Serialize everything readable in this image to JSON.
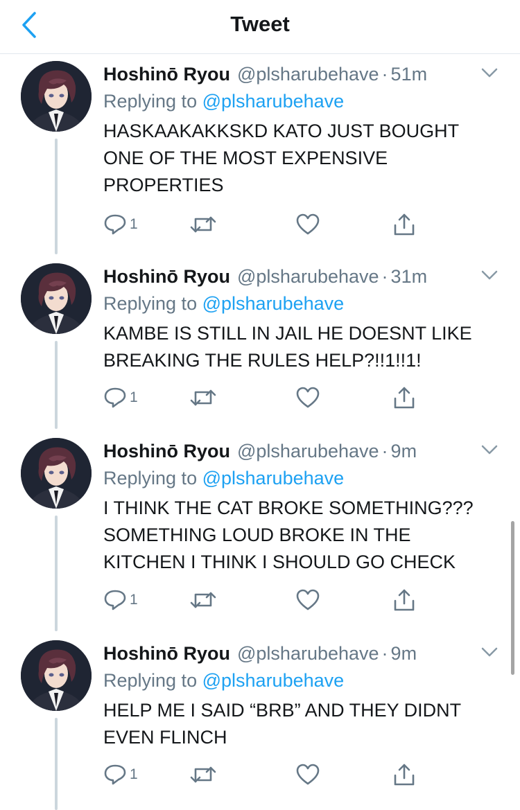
{
  "header": {
    "title": "Tweet",
    "back_icon": "chevron-left-icon",
    "accent": "#1da1f2"
  },
  "colors": {
    "mention": "#1da1f2",
    "muted": "#657786",
    "text": "#14171a",
    "thread_line": "#ccd6dd"
  },
  "tweets": [
    {
      "name": "Hoshinō Ryou",
      "handle": "@plsharubehave",
      "dot": "·",
      "time": "51m",
      "replying_prefix": "Replying to",
      "replying_to": "@plsharubehave",
      "lines": [
        "HASKAAKAKKSKD KATO JUST BOUGHT",
        "ONE OF THE MOST EXPENSIVE",
        "PROPERTIES"
      ],
      "reply_count": "1"
    },
    {
      "name": "Hoshinō Ryou",
      "handle": "@plsharubehave",
      "dot": "·",
      "time": "31m",
      "replying_prefix": "Replying to",
      "replying_to": "@plsharubehave",
      "lines": [
        "KAMBE IS STILL IN JAIL HE DOESNT LIKE",
        "BREAKING THE RULES HELP?!!1!!1!"
      ],
      "reply_count": "1"
    },
    {
      "name": "Hoshinō Ryou",
      "handle": "@plsharubehave",
      "dot": "·",
      "time": "9m",
      "replying_prefix": "Replying to",
      "replying_to": "@plsharubehave",
      "lines": [
        "I THINK THE CAT BROKE SOMETHING???",
        "SOMETHING LOUD BROKE IN THE",
        "KITCHEN I THINK I SHOULD GO CHECK"
      ],
      "reply_count": "1"
    },
    {
      "name": "Hoshinō Ryou",
      "handle": "@plsharubehave",
      "dot": "·",
      "time": "9m",
      "replying_prefix": "Replying to",
      "replying_to": "@plsharubehave",
      "lines": [
        "HELP ME I SAID “BRB” AND THEY DIDNT",
        "EVEN FLINCH"
      ],
      "reply_count": "1"
    }
  ],
  "icons": {
    "reply": "reply-icon",
    "retweet": "retweet-icon",
    "like": "heart-icon",
    "share": "share-icon",
    "more": "chevron-down-icon",
    "avatar": "avatar"
  }
}
